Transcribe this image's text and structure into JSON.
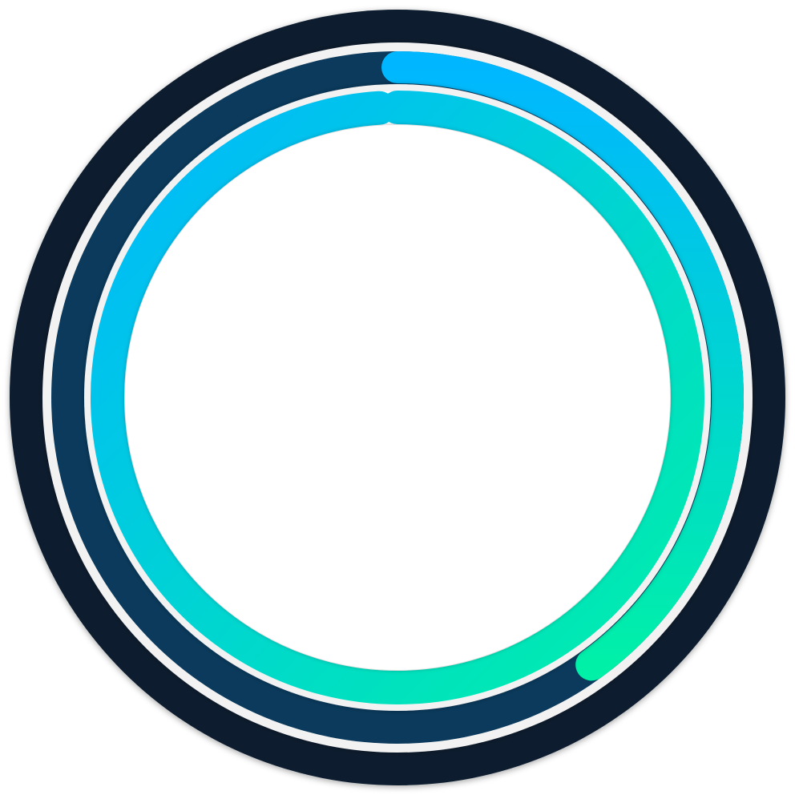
{
  "colors": {
    "bezel": "#081d2e",
    "ring_track": "#0b3a5c",
    "separator": "#f2f2f2",
    "inner_face": "#ffffff",
    "gradient_start": "#00b7ff",
    "gradient_end": "#00f0a8"
  },
  "progress": {
    "outer_ring": 0.4,
    "inner_ring": 0.99
  }
}
